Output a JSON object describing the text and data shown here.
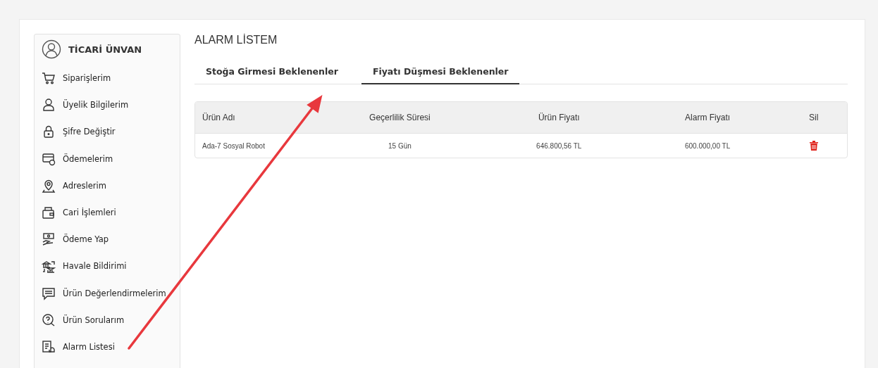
{
  "sidebar": {
    "title": "TİCARİ ÜNVAN",
    "items": [
      {
        "label": "Siparişlerim"
      },
      {
        "label": "Üyelik Bilgilerim"
      },
      {
        "label": "Şifre Değiştir"
      },
      {
        "label": "Ödemelerim"
      },
      {
        "label": "Adreslerim"
      },
      {
        "label": "Cari İşlemleri"
      },
      {
        "label": "Ödeme Yap"
      },
      {
        "label": "Havale Bildirimi"
      },
      {
        "label": "Ürün Değerlendirmelerim"
      },
      {
        "label": "Ürün Sorularım"
      },
      {
        "label": "Alarm Listesi"
      }
    ]
  },
  "page_title": "ALARM LİSTEM",
  "tabs": [
    {
      "label": "Stoğa Girmesi Beklenenler",
      "selected": false
    },
    {
      "label": "Fiyatı Düşmesi Beklenenler",
      "selected": true
    }
  ],
  "table": {
    "columns": [
      "Ürün Adı",
      "Geçerlilik Süresi",
      "Ürün Fiyatı",
      "Alarm Fiyatı",
      "Sil"
    ],
    "rows": [
      {
        "cells": [
          "Ada-7 Sosyal Robot",
          "15 Gün",
          "646.800,56  TL",
          "600.000,00 TL"
        ]
      }
    ]
  }
}
